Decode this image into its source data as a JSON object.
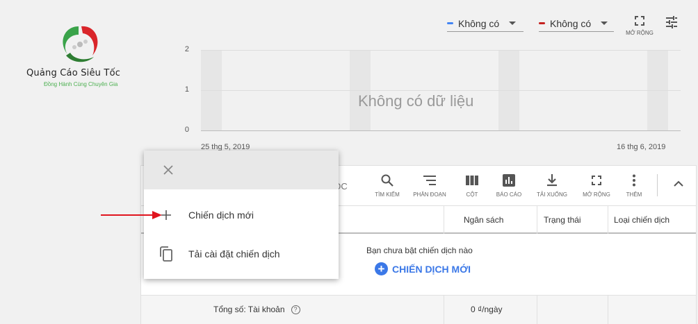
{
  "logo": {
    "title": "Quảng Cáo Siêu Tốc",
    "subtitle": "Đồng Hành Cùng Chuyên Gia"
  },
  "metrics": {
    "metric1": {
      "label": "Không có",
      "color": "#4285f4"
    },
    "metric2": {
      "label": "Không có",
      "color": "#c5221f"
    }
  },
  "chart_controls": {
    "expand_label": "MỞ RỘNG",
    "adjust_icon": "tune-icon"
  },
  "chart": {
    "yticks": [
      "2",
      "1",
      "0"
    ],
    "no_data": "Không có dữ liệu",
    "x_start": "25 thg 5, 2019",
    "x_end": "16 thg 6, 2019"
  },
  "chart_data": {
    "type": "line",
    "title": "",
    "x": [
      "25 thg 5, 2019",
      "16 thg 6, 2019"
    ],
    "series": [],
    "ylim": [
      0,
      2
    ],
    "yticks": [
      0,
      1,
      2
    ],
    "grid": true,
    "annotations": [
      "Không có dữ liệu"
    ]
  },
  "toolbar": {
    "filter_label": "LỌC",
    "search": "TÌM KIẾM",
    "segment": "PHÂN ĐOẠN",
    "columns": "CỘT",
    "reports": "BÁO CÁO",
    "download": "TẢI XUỐNG",
    "expand": "MỞ RỘNG",
    "more": "THÊM"
  },
  "table": {
    "columns": [
      "Ngân sách",
      "Trạng thái",
      "Loại chiến dịch"
    ],
    "empty_message": "Bạn chưa bật chiến dịch nào",
    "new_campaign_link": "CHIẾN DỊCH MỚI",
    "total_label": "Tổng số: Tài khoản",
    "total_budget": "0 ₫/ngày"
  },
  "popup": {
    "items": [
      {
        "label": "Chiến dịch mới",
        "icon": "plus-icon"
      },
      {
        "label": "Tải cài đặt chiến dịch",
        "icon": "copy-icon"
      }
    ]
  }
}
